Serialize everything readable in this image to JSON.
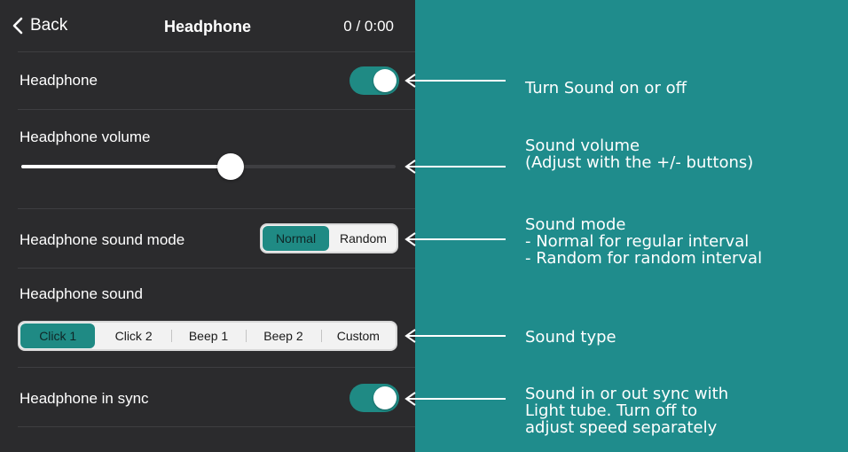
{
  "nav": {
    "back_label": "Back",
    "title": "Headphone",
    "timer": "0 / 0:00"
  },
  "rows": {
    "headphone": {
      "label": "Headphone",
      "enabled": true
    },
    "volume": {
      "label": "Headphone volume",
      "value": 0.56
    },
    "mode": {
      "label": "Headphone sound mode",
      "options": [
        "Normal",
        "Random"
      ],
      "selected": "Normal"
    },
    "sound": {
      "label": "Headphone sound",
      "options": [
        "Click 1",
        "Click 2",
        "Beep 1",
        "Beep 2",
        "Custom"
      ],
      "selected": "Click 1"
    },
    "sync": {
      "label": "Headphone in sync",
      "enabled": true
    }
  },
  "annotations": {
    "headphone": "Turn Sound on or off",
    "volume": "Sound volume\n(Adjust with the +/- buttons)",
    "mode": "Sound mode\n- Normal for regular interval\n- Random for random interval",
    "sound": "Sound type",
    "sync": "Sound in or out sync with\nLight tube. Turn off to\nadjust speed separately"
  },
  "colors": {
    "accent": "#1f8a84",
    "panel": "#2b2b2d",
    "annotation_bg": "#1f8c8c"
  },
  "icons": {
    "back": "chevron-left-icon",
    "arrow": "arrow-left-icon"
  }
}
